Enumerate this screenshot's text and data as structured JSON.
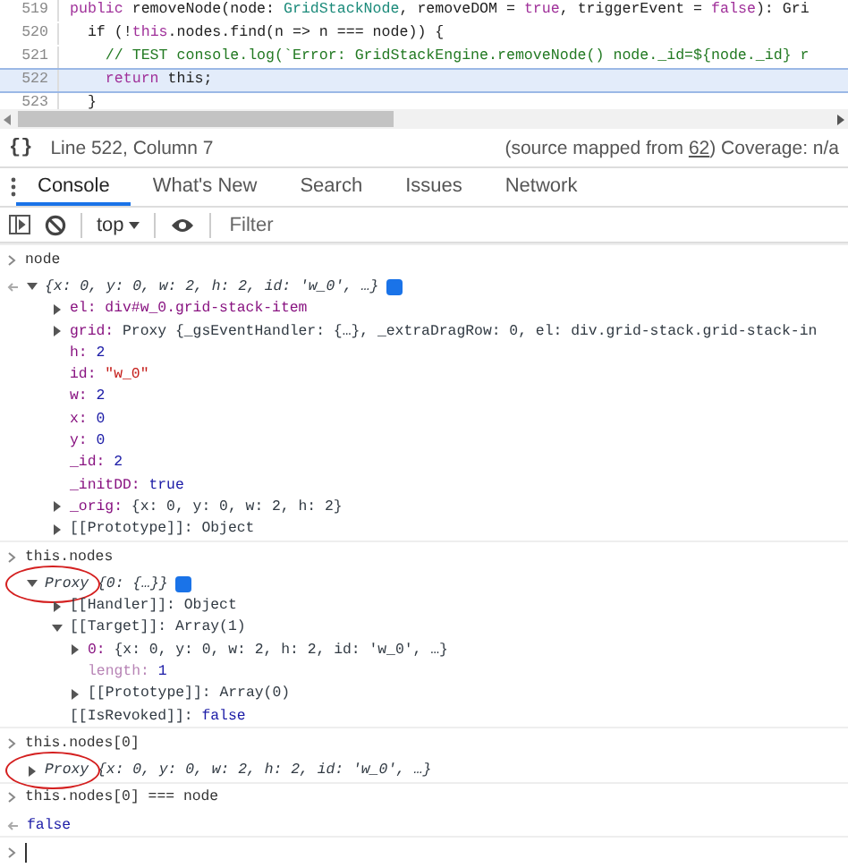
{
  "editor": {
    "lines": [
      {
        "number": "519",
        "selected": false,
        "segments": [
          {
            "text": "public",
            "kind": "keyword"
          },
          {
            "text": " removeNode(node: ",
            "kind": "plain"
          },
          {
            "text": "GridStackNode",
            "kind": "type"
          },
          {
            "text": ", removeDOM = ",
            "kind": "plain"
          },
          {
            "text": "true",
            "kind": "keyword"
          },
          {
            "text": ", triggerEvent = ",
            "kind": "plain"
          },
          {
            "text": "false",
            "kind": "keyword"
          },
          {
            "text": "): Gri",
            "kind": "plain"
          }
        ]
      },
      {
        "number": "520",
        "selected": false,
        "segments": [
          {
            "text": "  if (!",
            "kind": "plain"
          },
          {
            "text": "this",
            "kind": "keyword"
          },
          {
            "text": ".nodes.find(n => n === node)) {",
            "kind": "plain"
          }
        ]
      },
      {
        "number": "521",
        "selected": false,
        "segments": [
          {
            "text": "    // TEST console.log(`Error: GridStackEngine.removeNode() node._id=${node._id} r",
            "kind": "comment"
          }
        ]
      },
      {
        "number": "522",
        "selected": true,
        "segments": [
          {
            "text": "    return",
            "kind": "keyword"
          },
          {
            "text": " this;",
            "kind": "plain"
          }
        ]
      },
      {
        "number": "523",
        "selected": false,
        "segments": [
          {
            "text": "  }",
            "kind": "plain"
          }
        ]
      }
    ]
  },
  "status_bar": {
    "format_button": "{}",
    "position": "Line 522, Column 7",
    "source_prefix": "(source mapped from ",
    "source_link": "62",
    "source_suffix": ") Coverage: n/a"
  },
  "tabs": [
    {
      "label": "Console",
      "selected": true
    },
    {
      "label": "What's New",
      "selected": false
    },
    {
      "label": "Search",
      "selected": false
    },
    {
      "label": "Issues",
      "selected": false
    },
    {
      "label": "Network",
      "selected": false
    }
  ],
  "toolbar": {
    "context": "top",
    "filter_placeholder": "Filter"
  },
  "console": [
    {
      "kind": "input",
      "text": "node"
    },
    {
      "kind": "result",
      "circled": false,
      "preview": "{x: 0, y: 0, w: 2, h: 2, id: 'w_0', …}",
      "expanded": true,
      "badge": true,
      "children": [
        {
          "kind": "property",
          "key": "el:",
          "value": {
            "text": "div#w_0.grid-stack-item",
            "kind": "element"
          },
          "expanded": false
        },
        {
          "kind": "property",
          "key": "grid:",
          "value": {
            "text": "Proxy {_gsEventHandler: {…}, _extraDragRow: 0, el: div.grid-stack.grid-stack-in",
            "kind": "object"
          },
          "expanded": false
        },
        {
          "kind": "property",
          "key": "h:",
          "value": {
            "text": "2",
            "kind": "number"
          }
        },
        {
          "kind": "property",
          "key": "id:",
          "value": {
            "text": "\"w_0\"",
            "kind": "string"
          }
        },
        {
          "kind": "property",
          "key": "w:",
          "value": {
            "text": "2",
            "kind": "number"
          }
        },
        {
          "kind": "property",
          "key": "x:",
          "value": {
            "text": "0",
            "kind": "number"
          }
        },
        {
          "kind": "property",
          "key": "y:",
          "value": {
            "text": "0",
            "kind": "number"
          }
        },
        {
          "kind": "property",
          "key": "_id:",
          "value": {
            "text": "2",
            "kind": "number"
          }
        },
        {
          "kind": "property",
          "key": "_initDD:",
          "value": {
            "text": "true",
            "kind": "boolean"
          }
        },
        {
          "kind": "property",
          "key": "_orig:",
          "value": {
            "text": "{x: 0, y: 0, w: 2, h: 2}",
            "kind": "object"
          },
          "expanded": false
        },
        {
          "kind": "internal",
          "key": "[[Prototype]]:",
          "value": {
            "text": "Object",
            "kind": "object"
          },
          "expanded": false
        }
      ]
    },
    {
      "kind": "input",
      "text": "this.nodes"
    },
    {
      "kind": "result",
      "circled": true,
      "label": "Proxy",
      "preview": "{0: {…}}",
      "expanded": true,
      "badge": true,
      "children": [
        {
          "kind": "internal",
          "key": "[[Handler]]:",
          "value": {
            "text": "Object",
            "kind": "object"
          },
          "expanded": false
        },
        {
          "kind": "internal",
          "key": "[[Target]]:",
          "value": {
            "text": "Array(1)",
            "kind": "object"
          },
          "expanded": true,
          "children": [
            {
              "kind": "property",
              "key": "0:",
              "value": {
                "text": "{x: 0, y: 0, w: 2, h: 2, id: 'w_0', …}",
                "kind": "object"
              },
              "expanded": false
            },
            {
              "kind": "hidden",
              "key": "length:",
              "value": {
                "text": "1",
                "kind": "number"
              }
            },
            {
              "kind": "internal",
              "key": "[[Prototype]]:",
              "value": {
                "text": "Array(0)",
                "kind": "object"
              },
              "expanded": false
            }
          ]
        },
        {
          "kind": "internal",
          "key": "[[IsRevoked]]:",
          "value": {
            "text": "false",
            "kind": "boolean"
          }
        }
      ]
    },
    {
      "kind": "input",
      "text": "this.nodes[0]"
    },
    {
      "kind": "result",
      "circled": true,
      "label": "Proxy",
      "preview": "{x: 0, y: 0, w: 2, h: 2, id: 'w_0', …}",
      "expanded": false,
      "badge": false
    },
    {
      "kind": "input",
      "text": "this.nodes[0] === node"
    },
    {
      "kind": "value",
      "value": {
        "text": "false",
        "kind": "boolean"
      }
    }
  ]
}
